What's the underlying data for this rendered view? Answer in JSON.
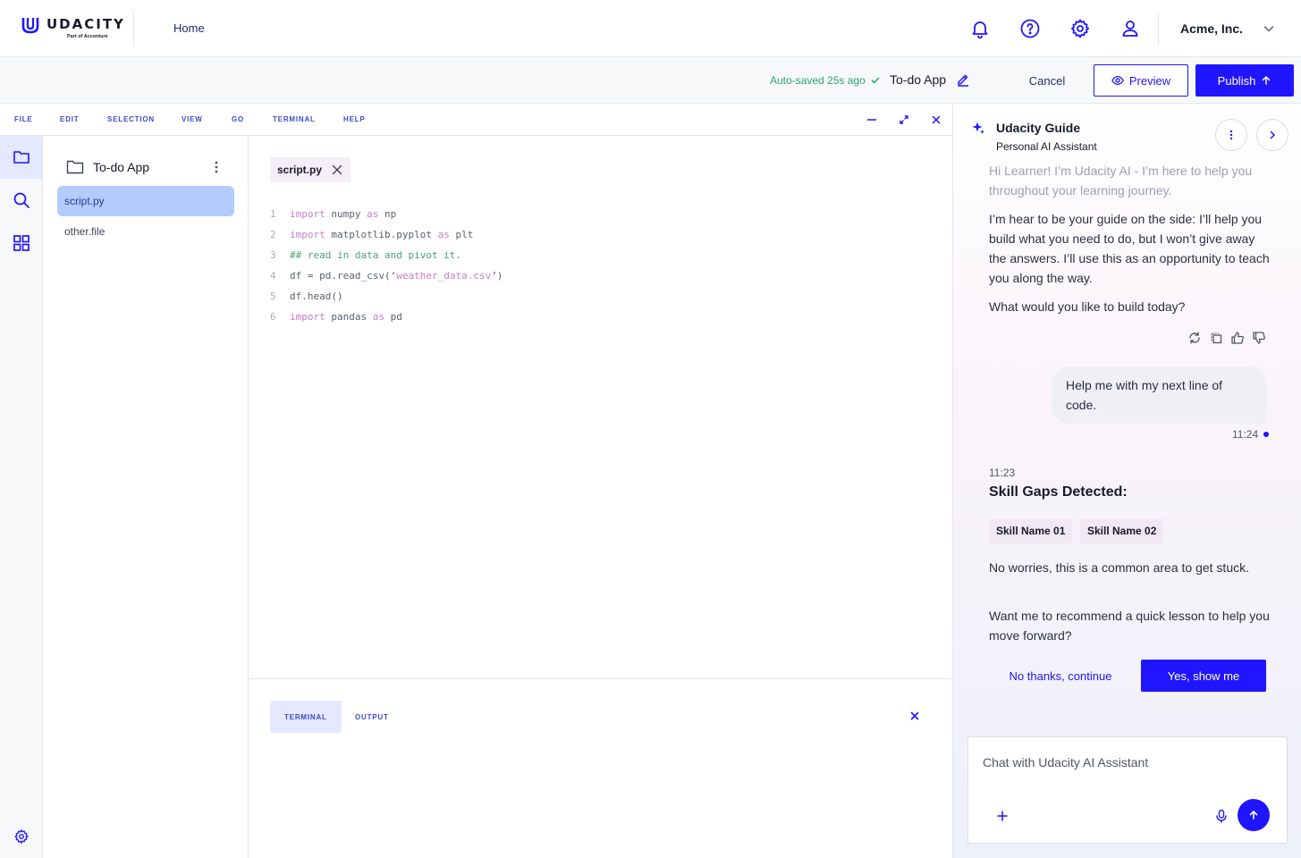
{
  "brand": {
    "name": "UDACITY",
    "tagline": "Part of Accenture",
    "accent": "#2015ff"
  },
  "header": {
    "home_label": "Home",
    "icons": [
      "bell-icon",
      "help-icon",
      "gear-icon",
      "user-icon"
    ],
    "org_name": "Acme, Inc."
  },
  "subbar": {
    "autosave": "Auto-saved 25s ago",
    "project_name": "To-do App",
    "cancel_label": "Cancel",
    "preview_label": "Preview",
    "publish_label": "Publish"
  },
  "menu": {
    "items": [
      "FILE",
      "EDIT",
      "SELECTION",
      "VIEW",
      "GO",
      "TERMINAL",
      "HELP"
    ]
  },
  "explorer": {
    "folder": "To-do App",
    "files": [
      "script.py",
      "other.file"
    ],
    "selected": "script.py"
  },
  "editor": {
    "tab_label": "script.py",
    "lines": [
      {
        "n": "1",
        "parts": [
          [
            "kw",
            "import"
          ],
          [
            "tx",
            " numpy "
          ],
          [
            "kw",
            "as"
          ],
          [
            "tx",
            " np"
          ]
        ]
      },
      {
        "n": "2",
        "parts": [
          [
            "kw",
            "import"
          ],
          [
            "tx",
            " matplotlib.pyplot "
          ],
          [
            "kw",
            "as"
          ],
          [
            "tx",
            " plt"
          ]
        ]
      },
      {
        "n": "3",
        "parts": [
          [
            "cm",
            "## read in data and pivot it."
          ]
        ]
      },
      {
        "n": "4",
        "parts": [
          [
            "tx",
            "df = pd.read_csv(‘"
          ],
          [
            "str",
            "weather_data.csv"
          ],
          [
            "tx",
            "’)"
          ]
        ]
      },
      {
        "n": "5",
        "parts": [
          [
            "tx",
            "df.head()"
          ]
        ]
      },
      {
        "n": "6",
        "parts": [
          [
            "kw",
            "import"
          ],
          [
            "tx",
            " pandas "
          ],
          [
            "kw",
            "as"
          ],
          [
            "tx",
            " pd"
          ]
        ]
      }
    ]
  },
  "panel": {
    "tabs": [
      "TERMINAL",
      "OUTPUT"
    ],
    "active": "TERMINAL"
  },
  "assistant": {
    "title": "Udacity Guide",
    "subtitle": "Personal AI Assistant",
    "intro_faded": "Hi Learner! I’m Udacity AI - I’m here to help you throughout your learning journey.",
    "intro_2": "I’m hear to be your guide on the side: I’ll help you build what you need to do, but I won’t give away the answers. I’ll use this as an opportunity to teach you along the way.",
    "intro_3": "What would you like to build today?",
    "user_message": "Help me with my next line of code.",
    "user_time": "11:24",
    "ai_time": "11:23",
    "gaps_title": "Skill Gaps Detected:",
    "skills": [
      "Skill Name 01",
      "Skill Name 02"
    ],
    "reply_1": "No worries, this is a common area to get stuck.",
    "reply_2": "Want me to recommend a quick lesson to help you move forward?",
    "secondary_action": "No thanks, continue",
    "primary_action": "Yes, show me",
    "chat_placeholder": "Chat with Udacity AI Assistant"
  }
}
